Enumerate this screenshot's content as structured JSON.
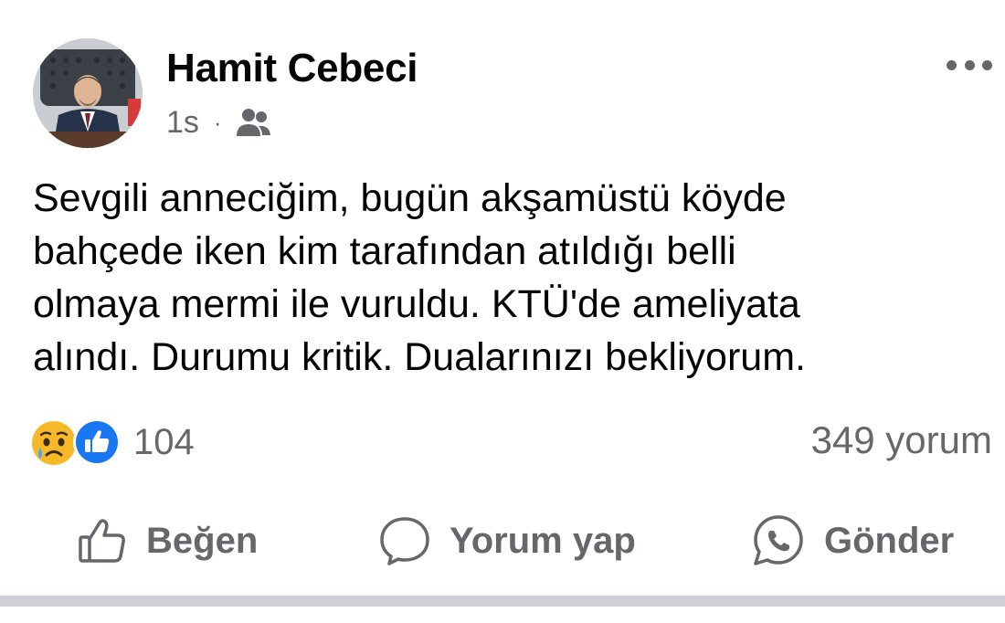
{
  "post": {
    "author": "Hamit Cebeci",
    "time": "1s",
    "separator_dot": "·",
    "audience_icon": "friends-icon",
    "more_icon": "more-options-icon",
    "text": "Sevgili anneciğim, bugün akşamüstü köyde\nbahçede iken kim tarafından atıldığı  belli\nolmaya mermi ile vuruldu. KTÜ'de ameliyata\nalındı. Durumu kritik. Dualarınızı bekliyorum."
  },
  "reactions": {
    "icons": [
      "sad-reaction-icon",
      "like-reaction-icon"
    ],
    "count": "104",
    "comments": "349 yorum"
  },
  "actions": {
    "like_label": "Beğen",
    "comment_label": "Yorum yap",
    "send_label": "Gönder"
  },
  "colors": {
    "text_primary": "#050505",
    "text_secondary": "#65676b",
    "like_blue": "#1877f2",
    "sad_yellow": "#f7b928",
    "divider": "#ced0d4"
  }
}
